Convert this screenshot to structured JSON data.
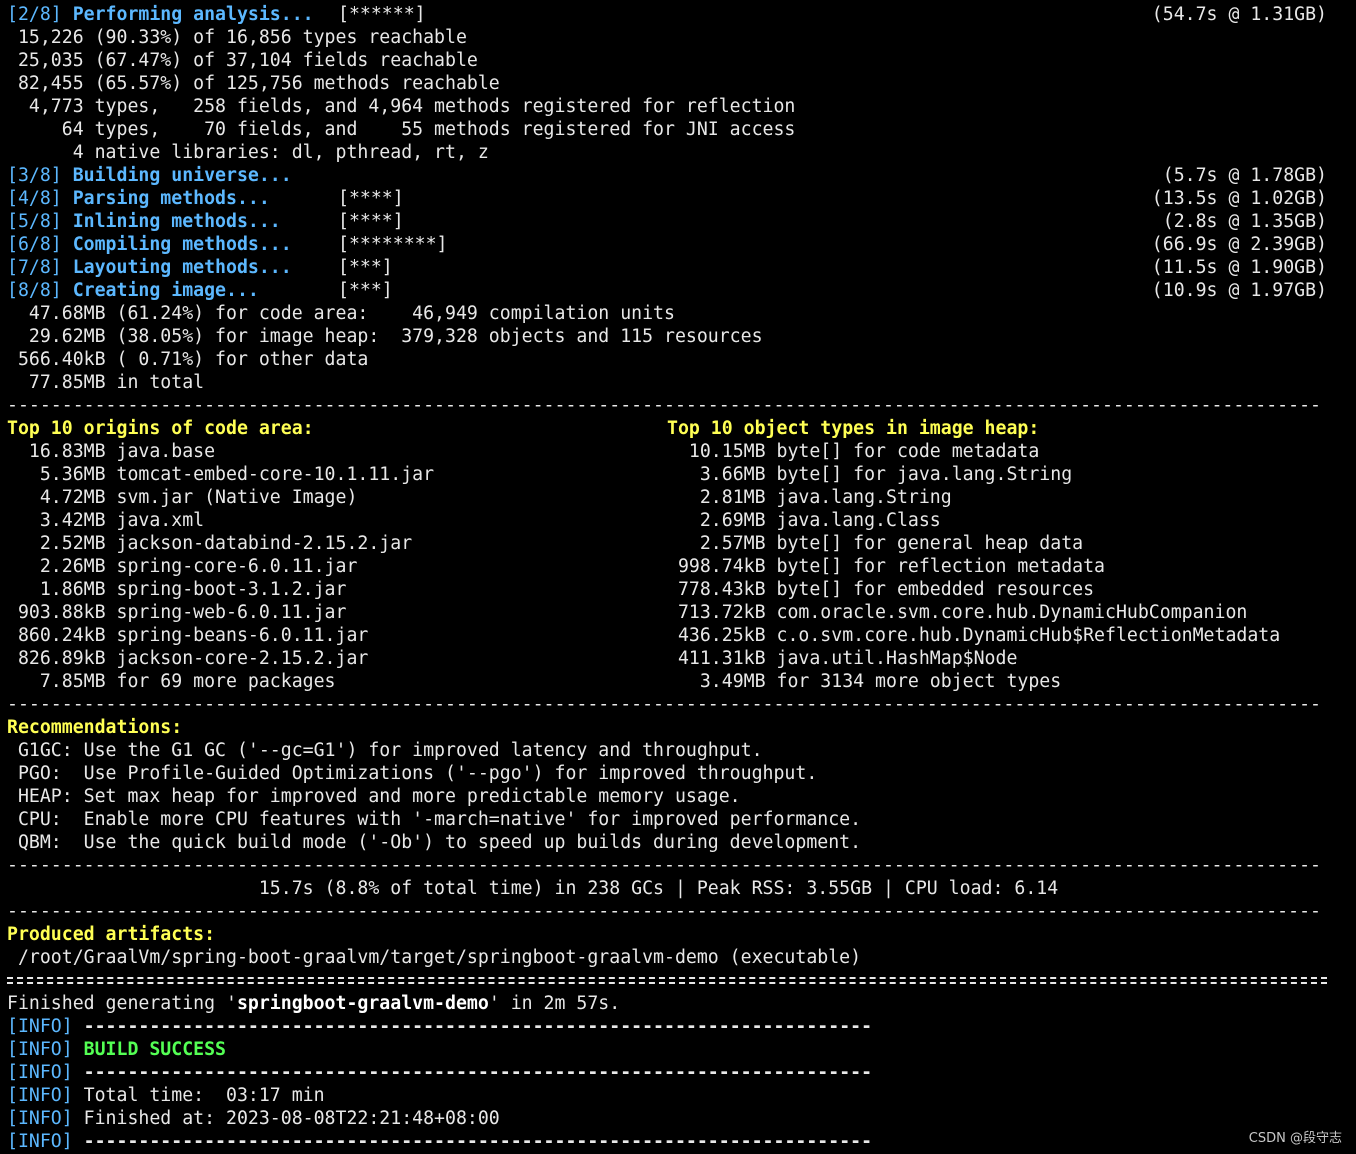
{
  "analysis": {
    "step": "[2/8]",
    "title": "Performing analysis...",
    "progress": "[******]",
    "timing": "(54.7s @ 1.31GB)",
    "lines": [
      " 15,226 (90.33%) of 16,856 types reachable",
      " 25,035 (67.47%) of 37,104 fields reachable",
      " 82,455 (65.57%) of 125,756 methods reachable",
      "  4,773 types,   258 fields, and 4,964 methods registered for reflection",
      "     64 types,    70 fields, and    55 methods registered for JNI access",
      "      4 native libraries: dl, pthread, rt, z"
    ]
  },
  "steps": [
    {
      "step": "[3/8]",
      "title": "Building universe...",
      "progress": "",
      "timing": "(5.7s @ 1.78GB)"
    },
    {
      "step": "[4/8]",
      "title": "Parsing methods...",
      "progress": "[****]",
      "timing": "(13.5s @ 1.02GB)"
    },
    {
      "step": "[5/8]",
      "title": "Inlining methods...",
      "progress": "[****]",
      "timing": "(2.8s @ 1.35GB)"
    },
    {
      "step": "[6/8]",
      "title": "Compiling methods...",
      "progress": "[********]",
      "timing": "(66.9s @ 2.39GB)"
    },
    {
      "step": "[7/8]",
      "title": "Layouting methods...",
      "progress": "[***]",
      "timing": "(11.5s @ 1.90GB)"
    },
    {
      "step": "[8/8]",
      "title": "Creating image...",
      "progress": "[***]",
      "timing": "(10.9s @ 1.97GB)"
    }
  ],
  "image_summary": [
    "  47.68MB (61.24%) for code area:    46,949 compilation units",
    "  29.62MB (38.05%) for image heap:  379,328 objects and 115 resources",
    " 566.40kB ( 0.71%) for other data",
    "  77.85MB in total"
  ],
  "separator": "------------------------------------------------------------------------------------------------------------------------",
  "top_origins": {
    "header": "Top 10 origins of code area:",
    "rows": [
      "  16.83MB java.base",
      "   5.36MB tomcat-embed-core-10.1.11.jar",
      "   4.72MB svm.jar (Native Image)",
      "   3.42MB java.xml",
      "   2.52MB jackson-databind-2.15.2.jar",
      "   2.26MB spring-core-6.0.11.jar",
      "   1.86MB spring-boot-3.1.2.jar",
      " 903.88kB spring-web-6.0.11.jar",
      " 860.24kB spring-beans-6.0.11.jar",
      " 826.89kB jackson-core-2.15.2.jar",
      "   7.85MB for 69 more packages"
    ]
  },
  "top_objects": {
    "header": "Top 10 object types in image heap:",
    "rows": [
      "  10.15MB byte[] for code metadata",
      "   3.66MB byte[] for java.lang.String",
      "   2.81MB java.lang.String",
      "   2.69MB java.lang.Class",
      "   2.57MB byte[] for general heap data",
      " 998.74kB byte[] for reflection metadata",
      " 778.43kB byte[] for embedded resources",
      " 713.72kB com.oracle.svm.core.hub.DynamicHubCompanion",
      " 436.25kB c.o.svm.core.hub.DynamicHub$ReflectionMetadata",
      " 411.31kB java.util.HashMap$Node",
      "   3.49MB for 3134 more object types"
    ]
  },
  "recommendations": {
    "header": "Recommendations:",
    "rows": [
      " G1GC: Use the G1 GC ('--gc=G1') for improved latency and throughput.",
      " PGO:  Use Profile-Guided Optimizations ('--pgo') for improved throughput.",
      " HEAP: Set max heap for improved and more predictable memory usage.",
      " CPU:  Enable more CPU features with '-march=native' for improved performance.",
      " QBM:  Use the quick build mode ('-Ob') to speed up builds during development."
    ]
  },
  "gc_summary": "                       15.7s (8.8% of total time) in 238 GCs | Peak RSS: 3.55GB | CPU load: 6.14",
  "artifacts": {
    "header": "Produced artifacts:",
    "path": " /root/GraalVm/spring-boot-graalvm/target/springboot-graalvm-demo (executable)"
  },
  "finished": {
    "prefix": "Finished generating '",
    "name": "springboot-graalvm-demo",
    "suffix": "' in 2m 57s."
  },
  "maven": {
    "tag": "[INFO]",
    "dashes": " ------------------------------------------------------------------------",
    "build_success": "BUILD SUCCESS",
    "total_time": " Total time:  03:17 min",
    "finished_at": " Finished at: 2023-08-08T22:21:48+08:00"
  },
  "watermark": "CSDN @段守志"
}
